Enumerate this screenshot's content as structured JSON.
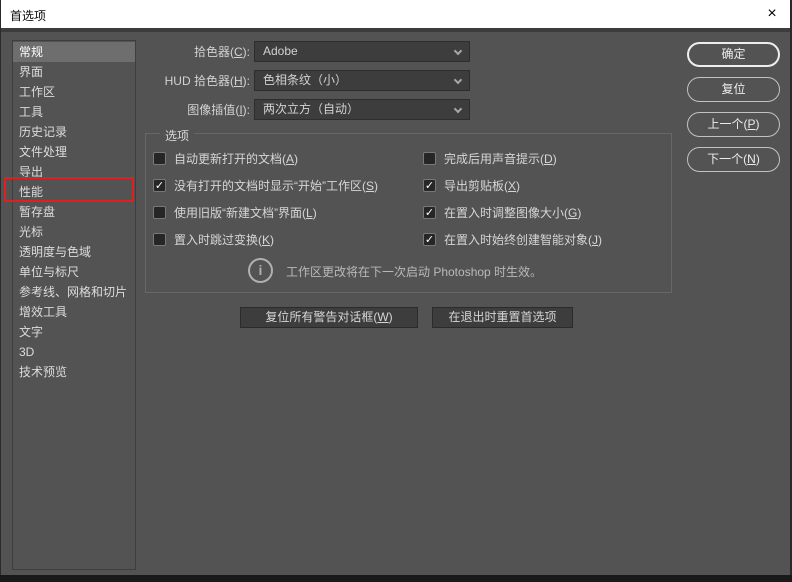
{
  "window": {
    "title": "首选项",
    "close_glyph": "×"
  },
  "punct": {
    "open": "(",
    "close": ")",
    "colon": ":"
  },
  "colors": {
    "titlebar_bg": "#ffffff",
    "dialog_bg": "#535353",
    "selected_item_bg": "#6e6e6e",
    "control_bg": "#3d3d3d",
    "annotation_red": "#e02020",
    "text_light": "#d6d6d6"
  },
  "sidebar": {
    "items": [
      {
        "label": "常规",
        "selected": true
      },
      {
        "label": "界面",
        "selected": false
      },
      {
        "label": "工作区",
        "selected": false
      },
      {
        "label": "工具",
        "selected": false
      },
      {
        "label": "历史记录",
        "selected": false
      },
      {
        "label": "文件处理",
        "selected": false
      },
      {
        "label": "导出",
        "selected": false
      },
      {
        "label": "性能",
        "selected": false
      },
      {
        "label": "暂存盘",
        "selected": false
      },
      {
        "label": "光标",
        "selected": false
      },
      {
        "label": "透明度与色域",
        "selected": false
      },
      {
        "label": "单位与标尺",
        "selected": false
      },
      {
        "label": "参考线、网格和切片",
        "selected": false
      },
      {
        "label": "增效工具",
        "selected": false
      },
      {
        "label": "文字",
        "selected": false
      },
      {
        "label": "3D",
        "selected": false
      },
      {
        "label": "技术预览",
        "selected": false
      }
    ]
  },
  "annotation": {
    "type": "red-box",
    "target": "性能",
    "color": "#e02020"
  },
  "fields": [
    {
      "label_text": "拾色器",
      "key": "C",
      "value": "Adobe"
    },
    {
      "label_text": "HUD 拾色器",
      "key": "H",
      "value": "色相条纹（小）"
    },
    {
      "label_text": "图像插值",
      "key": "I",
      "value": "两次立方（自动）"
    }
  ],
  "options_group": {
    "title": "选项",
    "left": [
      {
        "text": "自动更新打开的文档",
        "key": "A",
        "checked": false,
        "icon": ""
      },
      {
        "text": "没有打开的文档时显示“开始”工作区",
        "key": "S",
        "checked": true,
        "icon": "✓"
      },
      {
        "text": "使用旧版“新建文档”界面",
        "key": "L",
        "checked": false,
        "icon": ""
      },
      {
        "text": "置入时跳过变换",
        "key": "K",
        "checked": false,
        "icon": ""
      }
    ],
    "right": [
      {
        "text": "完成后用声音提示",
        "key": "D",
        "checked": false,
        "icon": ""
      },
      {
        "text": "导出剪贴板",
        "key": "X",
        "checked": true,
        "icon": "✓"
      },
      {
        "text": "在置入时调整图像大小",
        "key": "G",
        "checked": true,
        "icon": "✓"
      },
      {
        "text": "在置入时始终创建智能对象",
        "key": "J",
        "checked": true,
        "icon": "✓"
      }
    ],
    "note": {
      "icon_glyph": "i",
      "text": "工作区更改将在下一次启动 Photoshop 时生效。"
    }
  },
  "footer_buttons": {
    "reset_warnings": {
      "text": "复位所有警告对话框",
      "key": "W"
    },
    "reset_on_quit": {
      "text": "在退出时重置首选项"
    }
  },
  "action_buttons": {
    "ok": {
      "label": "确定"
    },
    "reset": {
      "label": "复位"
    },
    "prev": {
      "text": "上一个",
      "key": "P"
    },
    "next": {
      "text": "下一个",
      "key": "N"
    }
  }
}
